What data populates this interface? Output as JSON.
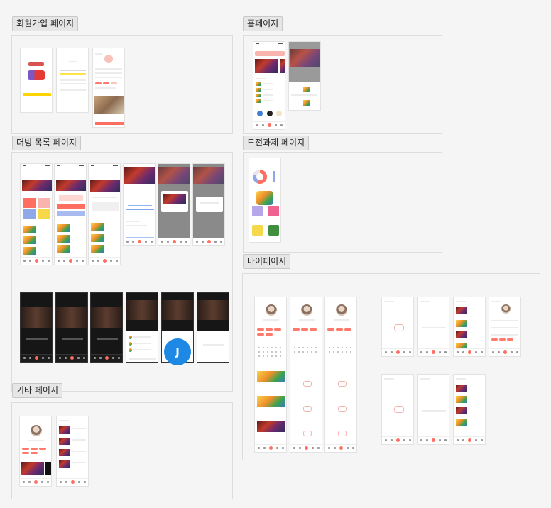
{
  "sections": {
    "signup": {
      "title": "회원가입 페이지"
    },
    "home": {
      "title": "홈페이지"
    },
    "dubbing_list": {
      "title": "더빙 목록 페이지"
    },
    "challenge": {
      "title": "도전과제 페이지"
    },
    "mypage": {
      "title": "마이페이지"
    },
    "etc": {
      "title": "기타 페이지"
    }
  },
  "collaborator_avatar": {
    "initial": "J",
    "color": "#1e88e5"
  },
  "colors": {
    "accent": "#ff6f61",
    "canvas": "#f5f5f5"
  }
}
